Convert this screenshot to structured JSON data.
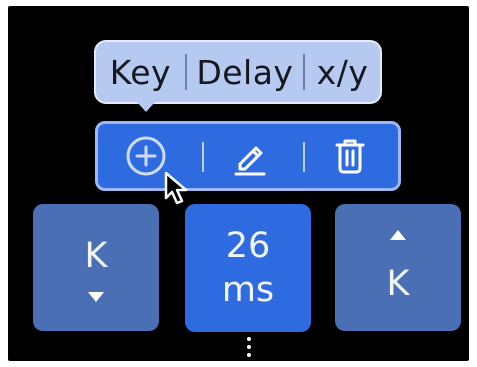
{
  "menu": {
    "items": [
      {
        "label": "Key"
      },
      {
        "label": "Delay"
      },
      {
        "label": "x/y"
      }
    ]
  },
  "toolbar": {
    "buttons": [
      {
        "icon": "plus-circle-icon"
      },
      {
        "icon": "pencil-icon"
      },
      {
        "icon": "trash-icon"
      }
    ]
  },
  "cards": {
    "left": {
      "label": "K",
      "arrow": "down"
    },
    "middle": {
      "value": "26",
      "unit": "ms"
    },
    "right": {
      "label": "K",
      "arrow": "up"
    }
  },
  "colors": {
    "background": "#000000",
    "popover": "#b6c9f0",
    "accent": "#2e6ae0",
    "card": "#4a6fb4"
  }
}
